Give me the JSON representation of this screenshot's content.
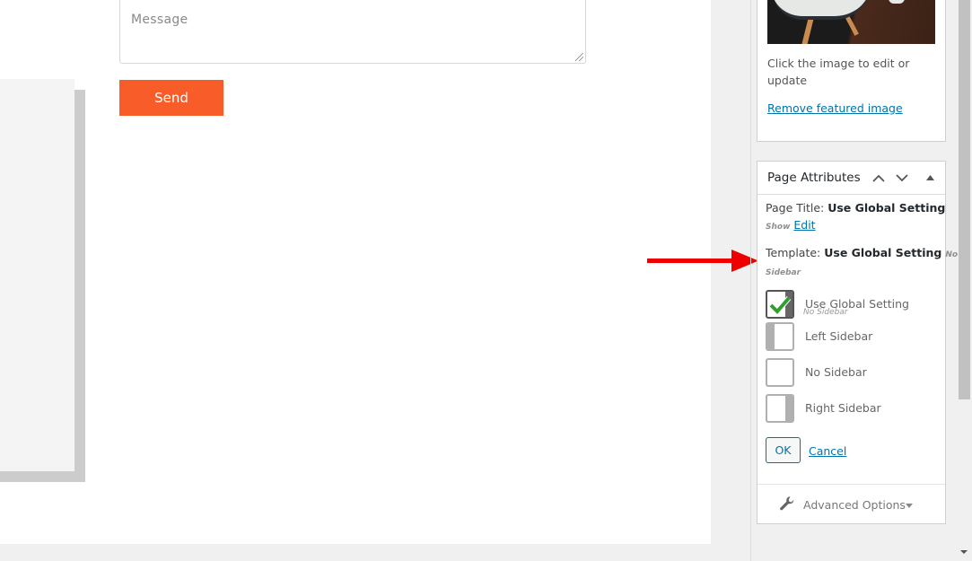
{
  "preview": {
    "message_placeholder": "Message",
    "send_label": "Send",
    "accent_color": "#f85c28"
  },
  "annotation": {
    "arrow_color": "#ee0000",
    "arrow_direction": "right"
  },
  "featured_image_panel": {
    "help_text": "Click the image to edit or update",
    "remove_link": "Remove featured image"
  },
  "page_attributes": {
    "title": "Page Attributes",
    "move_up_icon": "chevron-up-icon",
    "move_down_icon": "chevron-down-icon",
    "toggle_icon": "triangle-up-icon",
    "page_title_label": "Page Title:",
    "page_title_value": "Use Global Setting",
    "page_title_sub": "Show",
    "page_title_edit": "Edit",
    "template_label": "Template:",
    "template_value": "Use Global Setting",
    "template_sub": "No Sidebar",
    "layout_options": [
      {
        "label": "Use Global Setting",
        "sub": "No Sidebar",
        "selected": true,
        "icon": "check-icon"
      },
      {
        "label": "Left Sidebar",
        "sub": "",
        "selected": false,
        "icon": "left-sidebar-layout-icon"
      },
      {
        "label": "No Sidebar",
        "sub": "",
        "selected": false,
        "icon": "no-sidebar-layout-icon"
      },
      {
        "label": "Right Sidebar",
        "sub": "",
        "selected": false,
        "icon": "right-sidebar-layout-icon"
      }
    ],
    "ok_label": "OK",
    "cancel_label": "Cancel",
    "advanced_label": "Advanced Options",
    "link_color": "#0073aa",
    "check_color": "#2ea02e"
  }
}
